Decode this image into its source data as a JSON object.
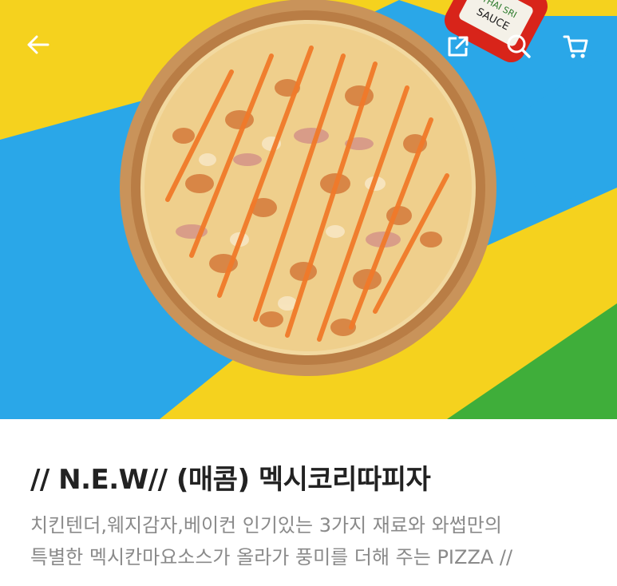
{
  "header": {
    "back_icon": "arrow-left-icon",
    "share_icon": "share-icon",
    "search_icon": "search-icon",
    "cart_icon": "cart-icon"
  },
  "hero": {
    "image": "pizza-photo",
    "sauce_label": "THAI SRI ... SAUCE",
    "colors": {
      "yellow": "#f5d21e",
      "blue": "#2aa7e8",
      "green": "#3fae3a",
      "sauce": "#e96a1f"
    }
  },
  "product": {
    "title": "// N.E.W// (매콤) 멕시코리따피자",
    "description_lines": [
      "치킨텐더,웨지감자,베이컨 인기있는 3가지 재료와 와썹만의",
      "특별한 멕시칸마요소스가 올라가 풍미를 더해 주는 PIZZA //"
    ]
  }
}
